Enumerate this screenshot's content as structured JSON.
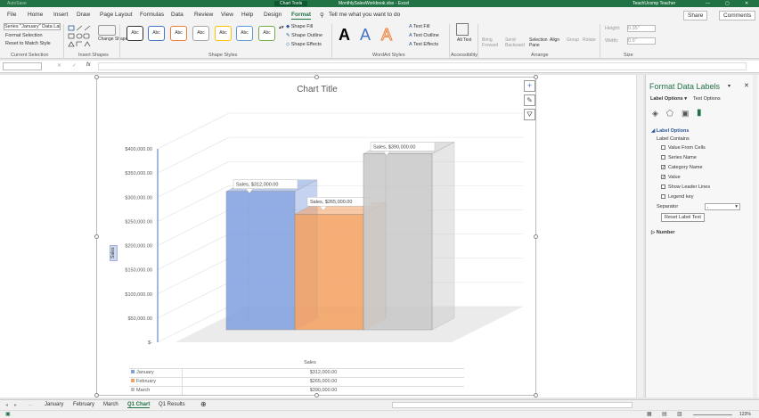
{
  "titlebar": {
    "autosave": "AutoSave",
    "context": "Chart Tools",
    "filename": "MonthlySalesWorkbook.xlsx - Excel",
    "user": "TeachUcomp Teacher"
  },
  "tabs": [
    "File",
    "Home",
    "Insert",
    "Draw",
    "Page Layout",
    "Formulas",
    "Data",
    "Review",
    "View",
    "Help",
    "Design",
    "Format"
  ],
  "tell_me": "Tell me what you want to do",
  "share": "Share",
  "comments": "Comments",
  "ribbon": {
    "selection_dropdown": "Series \"January\" Data Lal",
    "format_selection": "Format Selection",
    "reset_to_match": "Reset to Match Style",
    "current_selection": "Current Selection",
    "change_shape": "Change Shape",
    "insert_shapes": "Insert Shapes",
    "abc": "Abc",
    "shape_fill": "Shape Fill",
    "shape_outline": "Shape Outline",
    "shape_effects": "Shape Effects",
    "shape_styles": "Shape Styles",
    "wordart_letter": "A",
    "text_fill": "Text Fill",
    "text_outline": "Text Outline",
    "text_effects": "Text Effects",
    "wordart_styles": "WordArt Styles",
    "alt_text": "Alt Text",
    "accessibility": "Accessibility",
    "bring_forward": "Bring Forward",
    "send_backward": "Send Backward",
    "selection_pane": "Selection Pane",
    "align": "Align",
    "group": "Group",
    "rotate": "Rotate",
    "arrange": "Arrange",
    "height_label": "Height:",
    "height_value": "0.35\"",
    "width_label": "Width:",
    "width_value": "0.6\"",
    "size": "Size"
  },
  "formula": {
    "fx": "fx"
  },
  "chart": {
    "title": "Chart Title",
    "y_axis_label": "Sales",
    "x_axis_category": "Sales",
    "table_rows": [
      {
        "name": "January",
        "value": "$312,000.00",
        "color": "#7f9fe0"
      },
      {
        "name": "February",
        "value": "$265,000.00",
        "color": "#f5a060"
      },
      {
        "name": "March",
        "value": "$390,000.00",
        "color": "#bfbfbf"
      }
    ]
  },
  "chart_data": {
    "type": "bar",
    "title": "Chart Title",
    "categories": [
      "Sales"
    ],
    "series": [
      {
        "name": "January",
        "values": [
          312000
        ],
        "color": "#7f9fe0"
      },
      {
        "name": "February",
        "values": [
          265000
        ],
        "color": "#f5a060"
      },
      {
        "name": "March",
        "values": [
          390000
        ],
        "color": "#c8c8c8"
      }
    ],
    "data_labels": [
      "Sales, $312,000.00",
      "Sales, $265,000.00",
      "Sales, $390,000.00"
    ],
    "yticks": [
      "$400,000.00",
      "$350,000.00",
      "$300,000.00",
      "$250,000.00",
      "$200,000.00",
      "$150,000.00",
      "$100,000.00",
      "$50,000.00",
      "$-"
    ],
    "ylim": [
      0,
      400000
    ],
    "ylabel": "Sales",
    "xlabel": "Sales"
  },
  "pane": {
    "title": "Format Data Labels",
    "tab_label_options": "Label Options",
    "tab_text_options": "Text Options",
    "section": "Label Options",
    "label_contains": "Label Contains",
    "options": [
      {
        "label": "Value From Cells",
        "checked": false
      },
      {
        "label": "Series Name",
        "checked": false
      },
      {
        "label": "Category Name",
        "checked": true
      },
      {
        "label": "Value",
        "checked": true
      },
      {
        "label": "Show Leader Lines",
        "checked": false
      },
      {
        "label": "Legend key",
        "checked": false
      }
    ],
    "separator_label": "Separator",
    "separator_value": ",",
    "reset_button": "Reset Label Text",
    "number_section": "Number"
  },
  "sheets": [
    "January",
    "February",
    "March",
    "Q1 Chart",
    "Q1 Results"
  ],
  "active_sheet": "Q1 Chart",
  "zoom": "123%"
}
